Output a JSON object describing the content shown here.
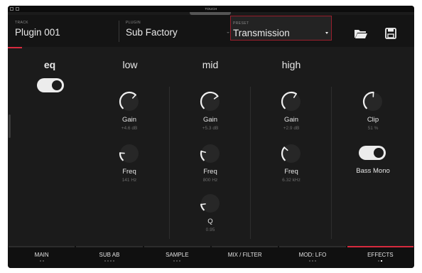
{
  "statusbar": {
    "title": "TOUCH"
  },
  "header": {
    "track": {
      "label": "TRACK",
      "value": "Plugin 001"
    },
    "plugin": {
      "label": "PLUGIN",
      "value": "Sub Factory"
    },
    "preset": {
      "label": "PRESET",
      "value": "Transmission"
    },
    "icons": [
      "folder-icon",
      "save-icon"
    ],
    "accent_color": "#d72a3e"
  },
  "main": {
    "eq": {
      "title": "eq",
      "toggle_on": true
    },
    "columns": {
      "low": {
        "title": "low",
        "gain": {
          "label": "Gain",
          "value": "+4.6 dB"
        },
        "freq": {
          "label": "Freq",
          "value": "141 Hz"
        }
      },
      "mid": {
        "title": "mid",
        "gain": {
          "label": "Gain",
          "value": "+5.3 dB"
        },
        "freq": {
          "label": "Freq",
          "value": "800 Hz"
        },
        "q": {
          "label": "Q",
          "value": "0.95"
        }
      },
      "high": {
        "title": "high",
        "gain": {
          "label": "Gain",
          "value": "+2.9 dB"
        },
        "freq": {
          "label": "Freq",
          "value": "6.32 kHz"
        }
      }
    },
    "clip": {
      "label": "Clip",
      "value": "51 %"
    },
    "bass_mono": {
      "label": "Bass Mono",
      "toggle_on": true
    }
  },
  "knob_levels": {
    "low_gain": 0.66,
    "low_freq": 0.18,
    "mid_gain": 0.7,
    "mid_freq": 0.22,
    "mid_q": 0.14,
    "high_gain": 0.62,
    "high_freq": 0.32,
    "clip": 0.51
  },
  "tabs": [
    {
      "label": "MAIN",
      "dots": 2,
      "active_dot": -1,
      "active": false
    },
    {
      "label": "SUB AB",
      "dots": 4,
      "active_dot": -1,
      "active": false
    },
    {
      "label": "SAMPLE",
      "dots": 3,
      "active_dot": -1,
      "active": false
    },
    {
      "label": "MIX / FILTER",
      "dots": 0,
      "active_dot": -1,
      "active": false
    },
    {
      "label": "MOD: LFO",
      "dots": 3,
      "active_dot": -1,
      "active": false
    },
    {
      "label": "EFFECTS",
      "dots": 2,
      "active_dot": 1,
      "active": true
    }
  ]
}
